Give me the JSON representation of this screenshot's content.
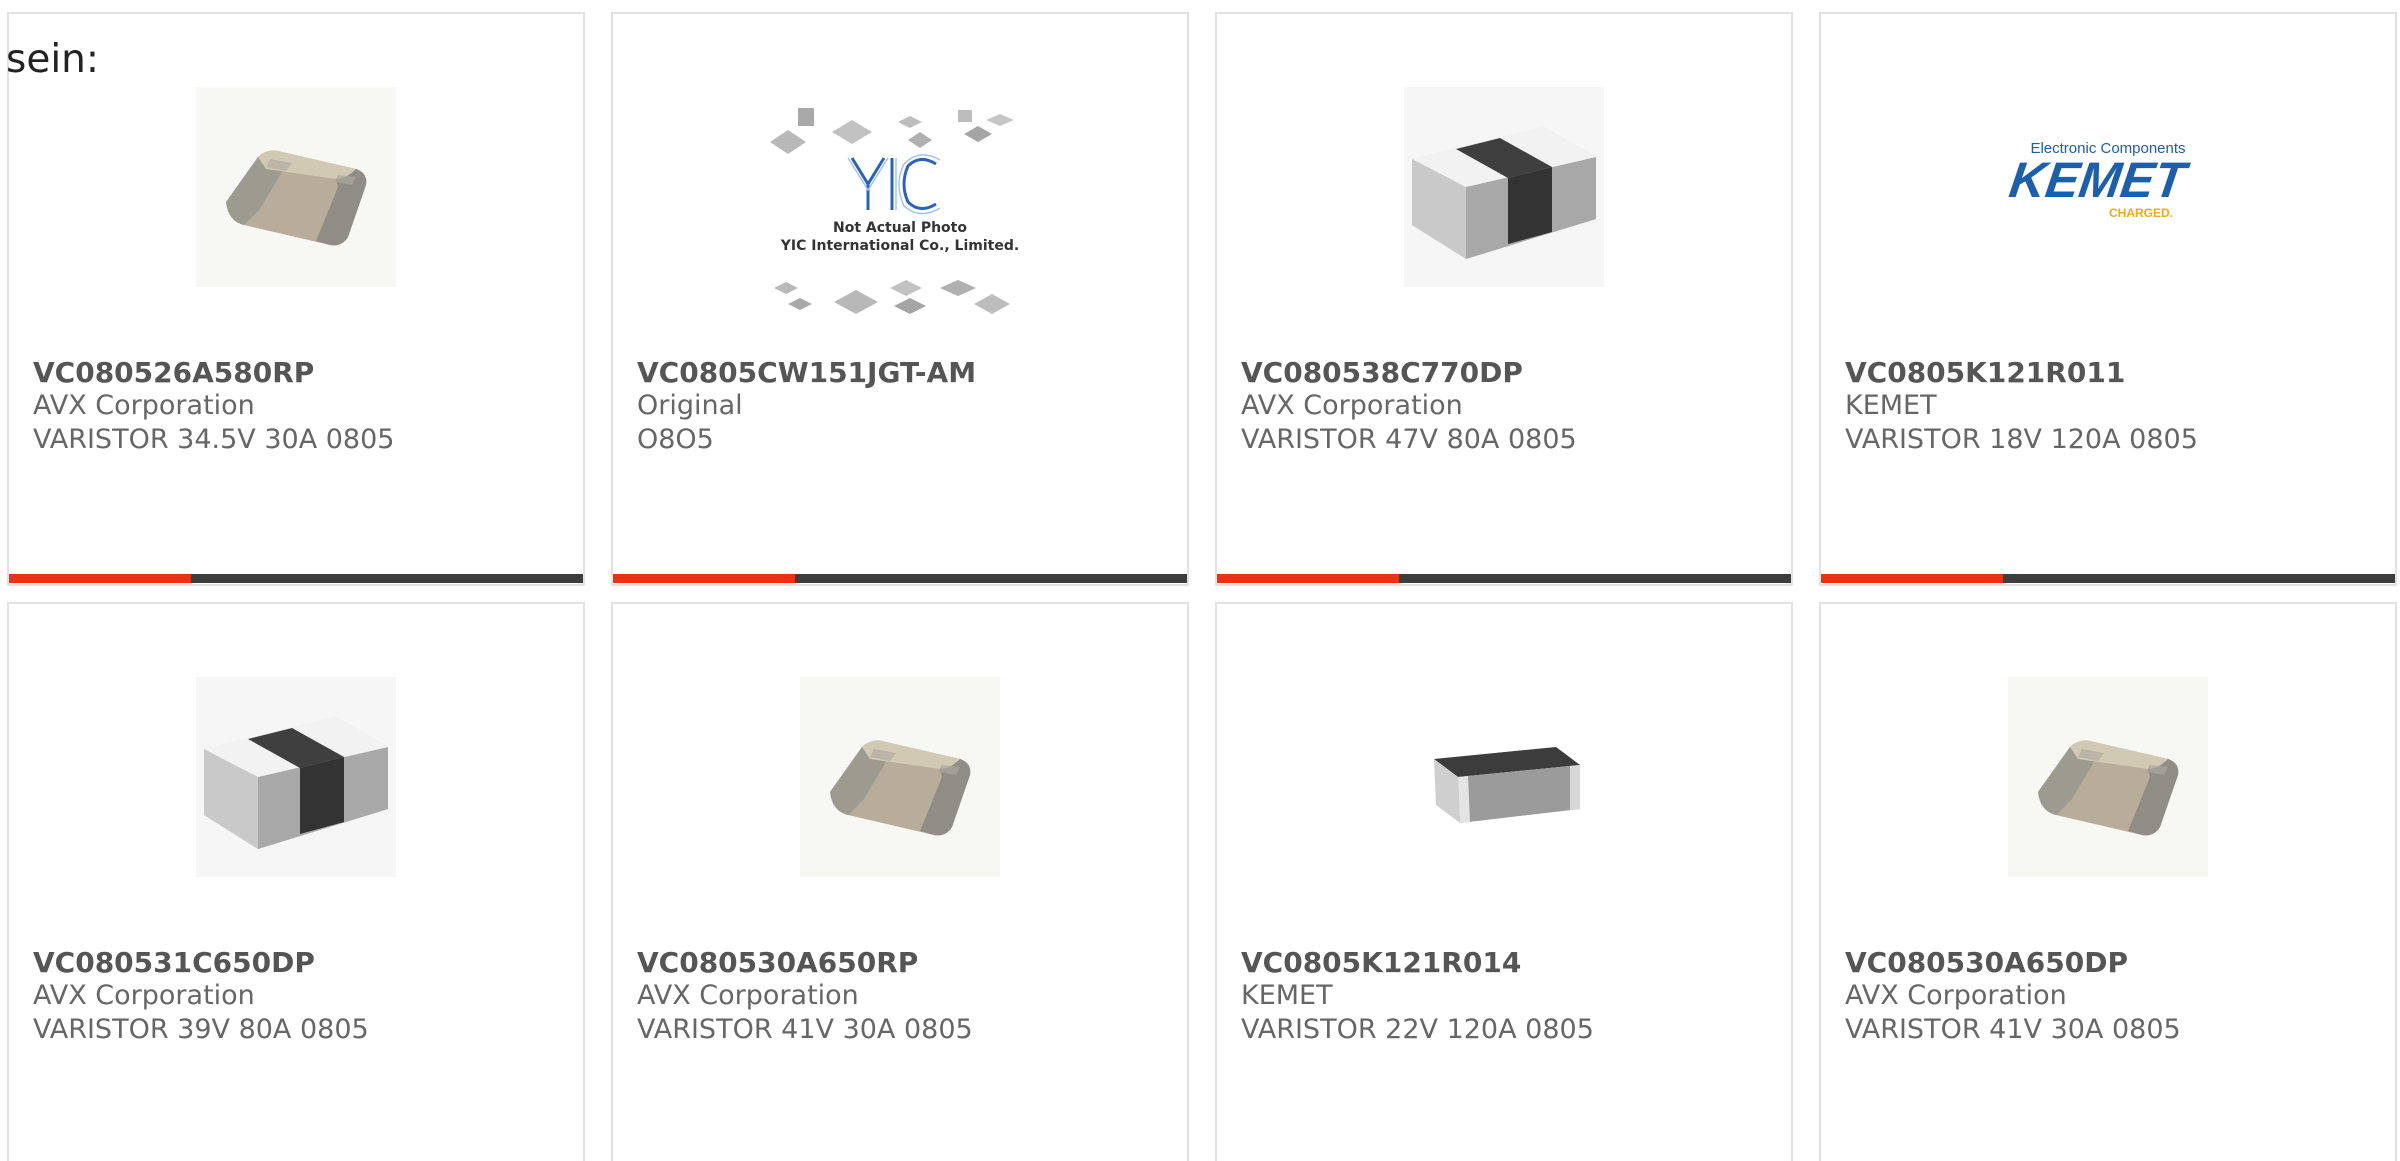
{
  "intro_text": "sein:",
  "colors": {
    "accent": "#e63312",
    "bar": "#3d3d3d",
    "kemet_blue": "#1d5fa8",
    "kemet_gold": "#f2a81d",
    "yic_blue": "#2a63b5"
  },
  "products": [
    {
      "part_number": "VC080526A580RP",
      "manufacturer": "AVX Corporation",
      "description": "VARISTOR 34.5V 30A 0805",
      "image": "ceramic-chip-beige-image"
    },
    {
      "part_number": "VC0805CW151JGT-AM",
      "manufacturer": "Original",
      "description": "O8O5",
      "image": "yic-placeholder-image",
      "placeholder_caption": [
        "Not Actual Photo",
        "YIC International Co., Limited."
      ]
    },
    {
      "part_number": "VC080538C770DP",
      "manufacturer": "AVX Corporation",
      "description": "VARISTOR 47V 80A 0805",
      "image": "white-black-chip-image"
    },
    {
      "part_number": "VC0805K121R011",
      "manufacturer": "KEMET",
      "description": "VARISTOR 18V 120A 0805",
      "image": "kemet-logo-image",
      "logo_text": {
        "tagline": "Electronic Components",
        "brand": "KEMET",
        "sub": "CHARGED."
      }
    },
    {
      "part_number": "VC080531C650DP",
      "manufacturer": "AVX Corporation",
      "description": "VARISTOR 39V 80A 0805",
      "image": "white-black-chip-image"
    },
    {
      "part_number": "VC080530A650RP",
      "manufacturer": "AVX Corporation",
      "description": "VARISTOR 41V 30A 0805",
      "image": "ceramic-chip-beige-image"
    },
    {
      "part_number": "VC0805K121R014",
      "manufacturer": "KEMET",
      "description": "VARISTOR 22V 120A 0805",
      "image": "grey-chip-image"
    },
    {
      "part_number": "VC080530A650DP",
      "manufacturer": "AVX Corporation",
      "description": "VARISTOR 41V 30A 0805",
      "image": "ceramic-chip-beige-image"
    }
  ]
}
